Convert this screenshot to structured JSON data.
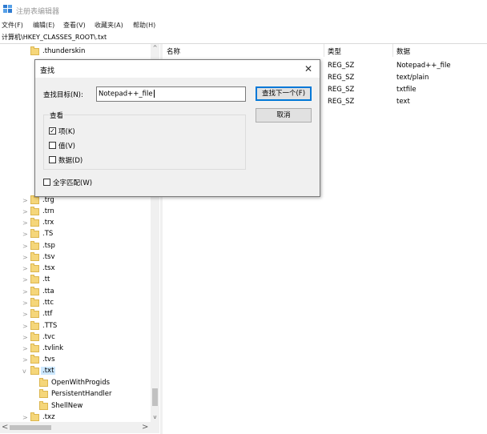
{
  "window": {
    "title": "注册表编辑器"
  },
  "menu": [
    "文件(F)",
    "编辑(E)",
    "查看(V)",
    "收藏夹(A)",
    "帮助(H)"
  ],
  "address": "计算机\\HKEY_CLASSES_ROOT\\.txt",
  "tree": [
    {
      "label": ".thunderskin",
      "expander": "",
      "indent": 0
    },
    {
      "label": ".trg",
      "expander": ">",
      "indent": 0
    },
    {
      "label": ".trn",
      "expander": ">",
      "indent": 0
    },
    {
      "label": ".trx",
      "expander": ">",
      "indent": 0
    },
    {
      "label": ".TS",
      "expander": ">",
      "indent": 0
    },
    {
      "label": ".tsp",
      "expander": ">",
      "indent": 0
    },
    {
      "label": ".tsv",
      "expander": ">",
      "indent": 0
    },
    {
      "label": ".tsx",
      "expander": ">",
      "indent": 0
    },
    {
      "label": ".tt",
      "expander": ">",
      "indent": 0
    },
    {
      "label": ".tta",
      "expander": ">",
      "indent": 0
    },
    {
      "label": ".ttc",
      "expander": ">",
      "indent": 0
    },
    {
      "label": ".ttf",
      "expander": ">",
      "indent": 0
    },
    {
      "label": ".TTS",
      "expander": ">",
      "indent": 0
    },
    {
      "label": ".tvc",
      "expander": ">",
      "indent": 0
    },
    {
      "label": ".tvlink",
      "expander": ">",
      "indent": 0
    },
    {
      "label": ".tvs",
      "expander": ">",
      "indent": 0
    },
    {
      "label": ".txt",
      "expander": "v",
      "indent": 0,
      "selected": true
    },
    {
      "label": "OpenWithProgids",
      "expander": "",
      "indent": 1
    },
    {
      "label": "PersistentHandler",
      "expander": "",
      "indent": 1
    },
    {
      "label": "ShellNew",
      "expander": "",
      "indent": 1
    },
    {
      "label": ".txz",
      "expander": ">",
      "indent": 0
    }
  ],
  "scrollbar": {
    "up": "^",
    "down": "v",
    "left": "<",
    "right": ">"
  },
  "list": {
    "headers": [
      "名称",
      "类型",
      "数据"
    ],
    "rows": [
      {
        "type": "REG_SZ",
        "data": "Notepad++_file"
      },
      {
        "type": "REG_SZ",
        "data": "text/plain"
      },
      {
        "type": "REG_SZ",
        "data": "txtfile"
      },
      {
        "type": "REG_SZ",
        "data": "text"
      }
    ]
  },
  "find_dialog": {
    "title": "查找",
    "close": "✕",
    "find_label": "查找目标(N):",
    "find_value": "Notepad++_file",
    "find_next_button": "查找下一个(F)",
    "cancel_button": "取消",
    "look_at_title": "查看",
    "options": [
      {
        "label": "项(K)",
        "checked": true
      },
      {
        "label": "值(V)",
        "checked": false
      },
      {
        "label": "数据(D)",
        "checked": false
      }
    ],
    "match_whole": {
      "label": "全字匹配(W)",
      "checked": false
    }
  },
  "colors": {
    "folder": "#f5d67a",
    "accent": "#0078d7",
    "selection": "#cce8ff"
  }
}
